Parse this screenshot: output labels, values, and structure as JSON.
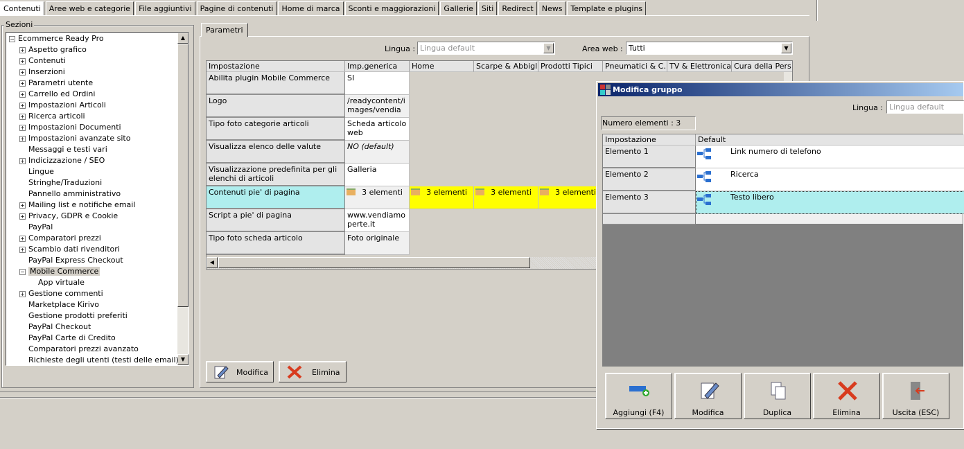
{
  "top_tabs": [
    "Contenuti",
    "Aree web e categorie",
    "File aggiuntivi",
    "Pagine di contenuti",
    "Home di marca",
    "Sconti e maggiorazioni",
    "Gallerie",
    "Siti",
    "Redirect",
    "News",
    "Template e plugins"
  ],
  "sections": {
    "title": "Sezioni",
    "root": "Ecommerce Ready Pro",
    "items": [
      {
        "label": "Aspetto grafico",
        "exp": true
      },
      {
        "label": "Contenuti",
        "exp": true
      },
      {
        "label": "Inserzioni",
        "exp": true
      },
      {
        "label": "Parametri utente",
        "exp": true
      },
      {
        "label": "Carrello ed Ordini",
        "exp": true
      },
      {
        "label": "Impostazioni Articoli",
        "exp": true
      },
      {
        "label": "Ricerca articoli",
        "exp": true
      },
      {
        "label": "Impostazioni Documenti",
        "exp": true
      },
      {
        "label": "Impostazioni avanzate sito",
        "exp": true
      },
      {
        "label": "Messaggi e testi vari",
        "exp": false
      },
      {
        "label": "Indicizzazione / SEO",
        "exp": true
      },
      {
        "label": "Lingue",
        "exp": false
      },
      {
        "label": "Stringhe/Traduzioni",
        "exp": false
      },
      {
        "label": "Pannello amministrativo",
        "exp": false
      },
      {
        "label": "Mailing list e notifiche email",
        "exp": true
      },
      {
        "label": "Privacy, GDPR e Cookie",
        "exp": true
      },
      {
        "label": "PayPal",
        "exp": false
      },
      {
        "label": "Comparatori prezzi",
        "exp": true
      },
      {
        "label": "Scambio dati rivenditori",
        "exp": true
      },
      {
        "label": "PayPal Express Checkout",
        "exp": false
      },
      {
        "label": "Mobile Commerce",
        "exp": "open",
        "selected": true
      },
      {
        "label": "App virtuale",
        "child": true
      },
      {
        "label": "Gestione commenti",
        "exp": true
      },
      {
        "label": "Marketplace Kirivo",
        "exp": false
      },
      {
        "label": "Gestione prodotti preferiti",
        "exp": false
      },
      {
        "label": "PayPal Checkout",
        "exp": false
      },
      {
        "label": "PayPal Carte di Credito",
        "exp": false
      },
      {
        "label": "Comparatori prezzi avanzato",
        "exp": false
      },
      {
        "label": "Richieste degli utenti (testi delle email)",
        "exp": false
      }
    ]
  },
  "params": {
    "tab": "Parametri",
    "lingua_label": "Lingua :",
    "lingua_value": "Lingua default",
    "area_label": "Area web :",
    "area_value": "Tutti",
    "columns": [
      "Impostazione",
      "Imp.generica",
      "Home",
      "Scarpe & Abbigl...",
      "Prodotti Tipici",
      "Pneumatici & C...",
      "TV & Elettronica",
      "Cura della Pers"
    ],
    "rows": [
      {
        "label": "Abilita plugin Mobile Commerce",
        "value": "SI"
      },
      {
        "label": "Logo",
        "value": "/readycontent/images/vendiamo..."
      },
      {
        "label": "Tipo foto categorie articoli",
        "value": "Scheda articolo web"
      },
      {
        "label": "Visualizza elenco delle valute",
        "value": "NO (default)",
        "italic": true
      },
      {
        "label": "Visualizzazione predefinita per gli elenchi di articoli",
        "value": "Galleria"
      },
      {
        "label": "Contenuti pie' di pagina",
        "value": "3 elementi",
        "group": true,
        "others": [
          "3 elementi",
          "3 elementi",
          "3 elementi"
        ]
      },
      {
        "label": "Script a pie' di pagina",
        "value": "www.vendiamoperte.it"
      },
      {
        "label": "Tipo foto scheda articolo",
        "value": "Foto originale"
      }
    ],
    "buttons": {
      "edit": "Modifica",
      "delete": "Elimina"
    }
  },
  "dialog": {
    "title": "Modifica gruppo",
    "lingua_label": "Lingua :",
    "lingua_value": "Lingua default",
    "count": "Numero elementi : 3",
    "columns": [
      "Impostazione",
      "Default"
    ],
    "rows": [
      {
        "label": "Elemento 1",
        "value": "Link numero di telefono"
      },
      {
        "label": "Elemento 2",
        "value": "Ricerca"
      },
      {
        "label": "Elemento 3",
        "value": "Testo libero"
      }
    ],
    "buttons": [
      "Aggiungi (F4)",
      "Modifica",
      "Duplica",
      "Elimina",
      "Uscita (ESC)"
    ]
  },
  "colors": {
    "highlight_yellow": "#ffff00",
    "selected_cyan": "#afeeee",
    "title_start": "#0a246a",
    "title_end": "#a6caf0"
  }
}
